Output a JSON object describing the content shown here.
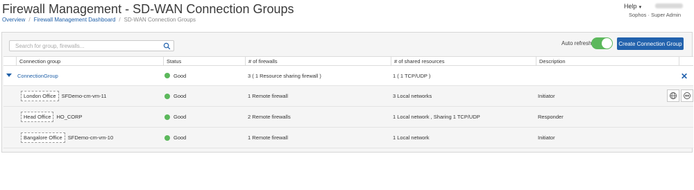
{
  "header": {
    "title": "Firewall Management - SD-WAN Connection Groups",
    "breadcrumb": [
      "Overview",
      "Firewall Management Dashboard",
      "SD-WAN Connection Groups"
    ],
    "help_label": "Help",
    "user_role": "Sophos · Super Admin"
  },
  "toolbar": {
    "search_placeholder": "Search for group, firewalls...",
    "auto_refresh_label": "Auto refresh",
    "auto_refresh_on": true,
    "create_label": "Create Connection Group"
  },
  "colors": {
    "accent": "#2262ad",
    "good": "#5cb85c"
  },
  "table": {
    "columns": [
      "Connection group",
      "Status",
      "# of firewalls",
      "# of shared resources",
      "Description"
    ],
    "group": {
      "name": "ConnectionGroup",
      "status": "Good",
      "firewalls": "3 ( 1 Resource sharing firewall )",
      "shared": "1 ( 1 TCP/UDP )",
      "description": ""
    },
    "members": [
      {
        "tag": "London Office",
        "name": "SFDemo-cm-vm-11",
        "status": "Good",
        "firewalls": "1 Remote firewall",
        "shared": "3 Local networks",
        "description": "Initiator"
      },
      {
        "tag": "Head Office",
        "name": "HO_CORP",
        "status": "Good",
        "firewalls": "2 Remote firewalls",
        "shared": "1 Local network , Sharing 1 TCP/UDP",
        "description": "Responder"
      },
      {
        "tag": "Bangalore Office",
        "name": "SFDemo-cm-vm-10",
        "status": "Good",
        "firewalls": "1 Remote firewall",
        "shared": "1 Local network",
        "description": "Initiator"
      }
    ]
  }
}
